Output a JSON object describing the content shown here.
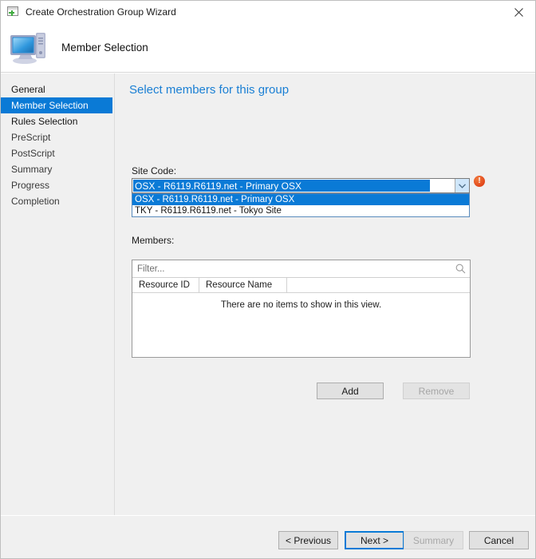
{
  "window": {
    "title": "Create Orchestration Group Wizard",
    "icon": "wizard-window-icon",
    "close_icon": "close-icon"
  },
  "header": {
    "title": "Member Selection",
    "icon": "computer-icon"
  },
  "sidebar": {
    "items": [
      {
        "label": "General",
        "state": "enabled",
        "selected": false
      },
      {
        "label": "Member Selection",
        "state": "enabled",
        "selected": true
      },
      {
        "label": "Rules Selection",
        "state": "enabled",
        "selected": false
      },
      {
        "label": "PreScript",
        "state": "disabled",
        "selected": false
      },
      {
        "label": "PostScript",
        "state": "disabled",
        "selected": false
      },
      {
        "label": "Summary",
        "state": "disabled",
        "selected": false
      },
      {
        "label": "Progress",
        "state": "disabled",
        "selected": false
      },
      {
        "label": "Completion",
        "state": "disabled",
        "selected": false
      }
    ]
  },
  "content": {
    "heading": "Select members for this group",
    "site_code": {
      "label": "Site Code:",
      "selected": "OSX - R6119.R6119.net - Primary OSX",
      "expanded": true,
      "arrow_icon": "chevron-down-icon",
      "options": [
        {
          "label": "OSX - R6119.R6119.net - Primary OSX",
          "highlighted": true
        },
        {
          "label": "TKY - R6119.R6119.net - Tokyo Site",
          "highlighted": false
        }
      ]
    },
    "members": {
      "label": "Members:",
      "filter_placeholder": "Filter...",
      "filter_value": "",
      "search_icon": "search-icon",
      "columns": [
        "Resource ID",
        "Resource Name"
      ],
      "rows": [],
      "empty_message": "There are no items to show in this view.",
      "error_badge": {
        "icon": "error-exclamation-icon",
        "glyph": "!",
        "color": "#e2471b"
      },
      "add_label": "Add",
      "remove_label": "Remove",
      "remove_enabled": false
    }
  },
  "footer": {
    "previous_label": "< Previous",
    "next_label": "Next >",
    "summary_label": "Summary",
    "cancel_label": "Cancel",
    "summary_enabled": false,
    "default_button": "Next >"
  },
  "colors": {
    "accent": "#0a7ad6",
    "heading": "#1a7fd4",
    "panel_bg": "#f0f0f0",
    "error": "#e2471b"
  }
}
